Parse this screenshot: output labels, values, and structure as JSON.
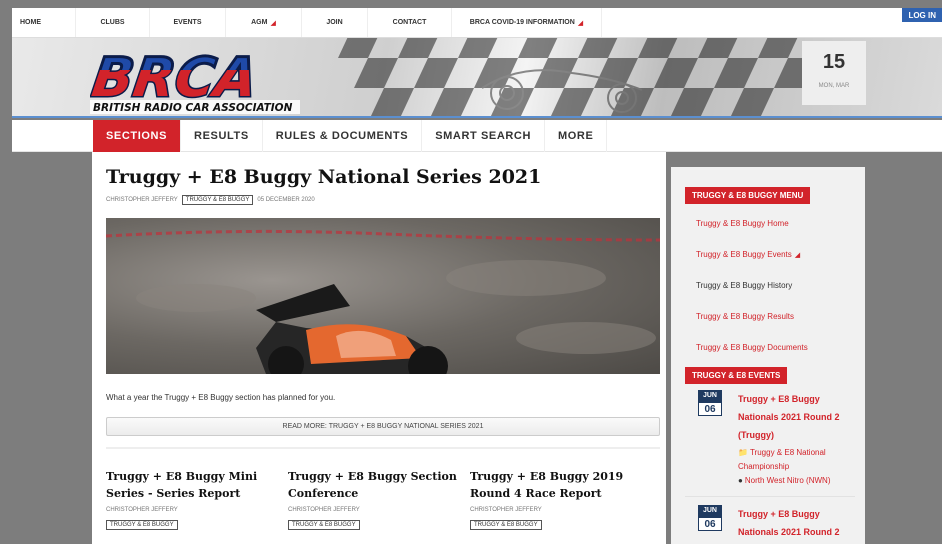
{
  "top_nav": {
    "items": [
      {
        "label": "HOME",
        "caret": false
      },
      {
        "label": "CLUBS",
        "caret": false
      },
      {
        "label": "EVENTS",
        "caret": false
      },
      {
        "label": "AGM",
        "caret": true
      },
      {
        "label": "JOIN",
        "caret": false
      },
      {
        "label": "CONTACT",
        "caret": false
      },
      {
        "label": "BRCA COVID-19 INFORMATION",
        "caret": true
      }
    ],
    "login_label": "LOG IN"
  },
  "banner": {
    "logo_text": "BRCA",
    "logo_subtitle": "BRITISH RADIO CAR ASSOCIATION",
    "date_day": "15",
    "date_sub": "MON, MAR"
  },
  "sub_nav": {
    "tabs": [
      "SECTIONS",
      "RESULTS",
      "RULES & DOCUMENTS",
      "SMART SEARCH",
      "MORE"
    ],
    "active_index": 0
  },
  "post": {
    "title": "Truggy + E8 Buggy National Series 2021",
    "author": "CHRISTOPHER JEFFERY",
    "tag": "TRUGGY & E8 BUGGY",
    "date": "05 DECEMBER 2020",
    "excerpt": "What a year the Truggy + E8 Buggy section has planned for you.",
    "read_more": "READ MORE: TRUGGY + E8 BUGGY NATIONAL SERIES 2021"
  },
  "related": [
    {
      "title": "Truggy + E8 Buggy Mini Series - Series Report",
      "author": "CHRISTOPHER JEFFERY",
      "tag": "TRUGGY & E8 BUGGY"
    },
    {
      "title": "Truggy + E8 Buggy Section Conference",
      "author": "CHRISTOPHER JEFFERY",
      "tag": "TRUGGY & E8 BUGGY"
    },
    {
      "title": "Truggy + E8 Buggy 2019 Round 4 Race Report",
      "author": "CHRISTOPHER JEFFERY",
      "tag": "TRUGGY & E8 BUGGY"
    }
  ],
  "sidebar": {
    "menu_heading": "TRUGGY & E8 BUGGY MENU",
    "menu": [
      {
        "label": "Truggy & E8 Buggy Home",
        "caret": false
      },
      {
        "label": "Truggy & E8 Buggy Events",
        "caret": true
      },
      {
        "label": "Truggy & E8 Buggy History",
        "caret": false
      },
      {
        "label": "Truggy & E8 Buggy Results",
        "caret": false
      },
      {
        "label": "Truggy & E8 Buggy Documents",
        "caret": false
      }
    ],
    "events_heading": "TRUGGY & E8 EVENTS",
    "events": [
      {
        "month": "JUN",
        "day": "06",
        "title": "Truggy + E8 Buggy Nationals 2021 Round 2 (Truggy)",
        "category": "Truggy & E8 National Championship",
        "location": "North West Nitro (NWN)"
      },
      {
        "month": "JUN",
        "day": "06",
        "title": "Truggy + E8 Buggy Nationals 2021 Round 2",
        "category": "",
        "location": ""
      }
    ]
  },
  "colors": {
    "accent_red": "#d2232a",
    "calendar_navy": "#1f3a60",
    "login_blue": "#2f62b0"
  }
}
